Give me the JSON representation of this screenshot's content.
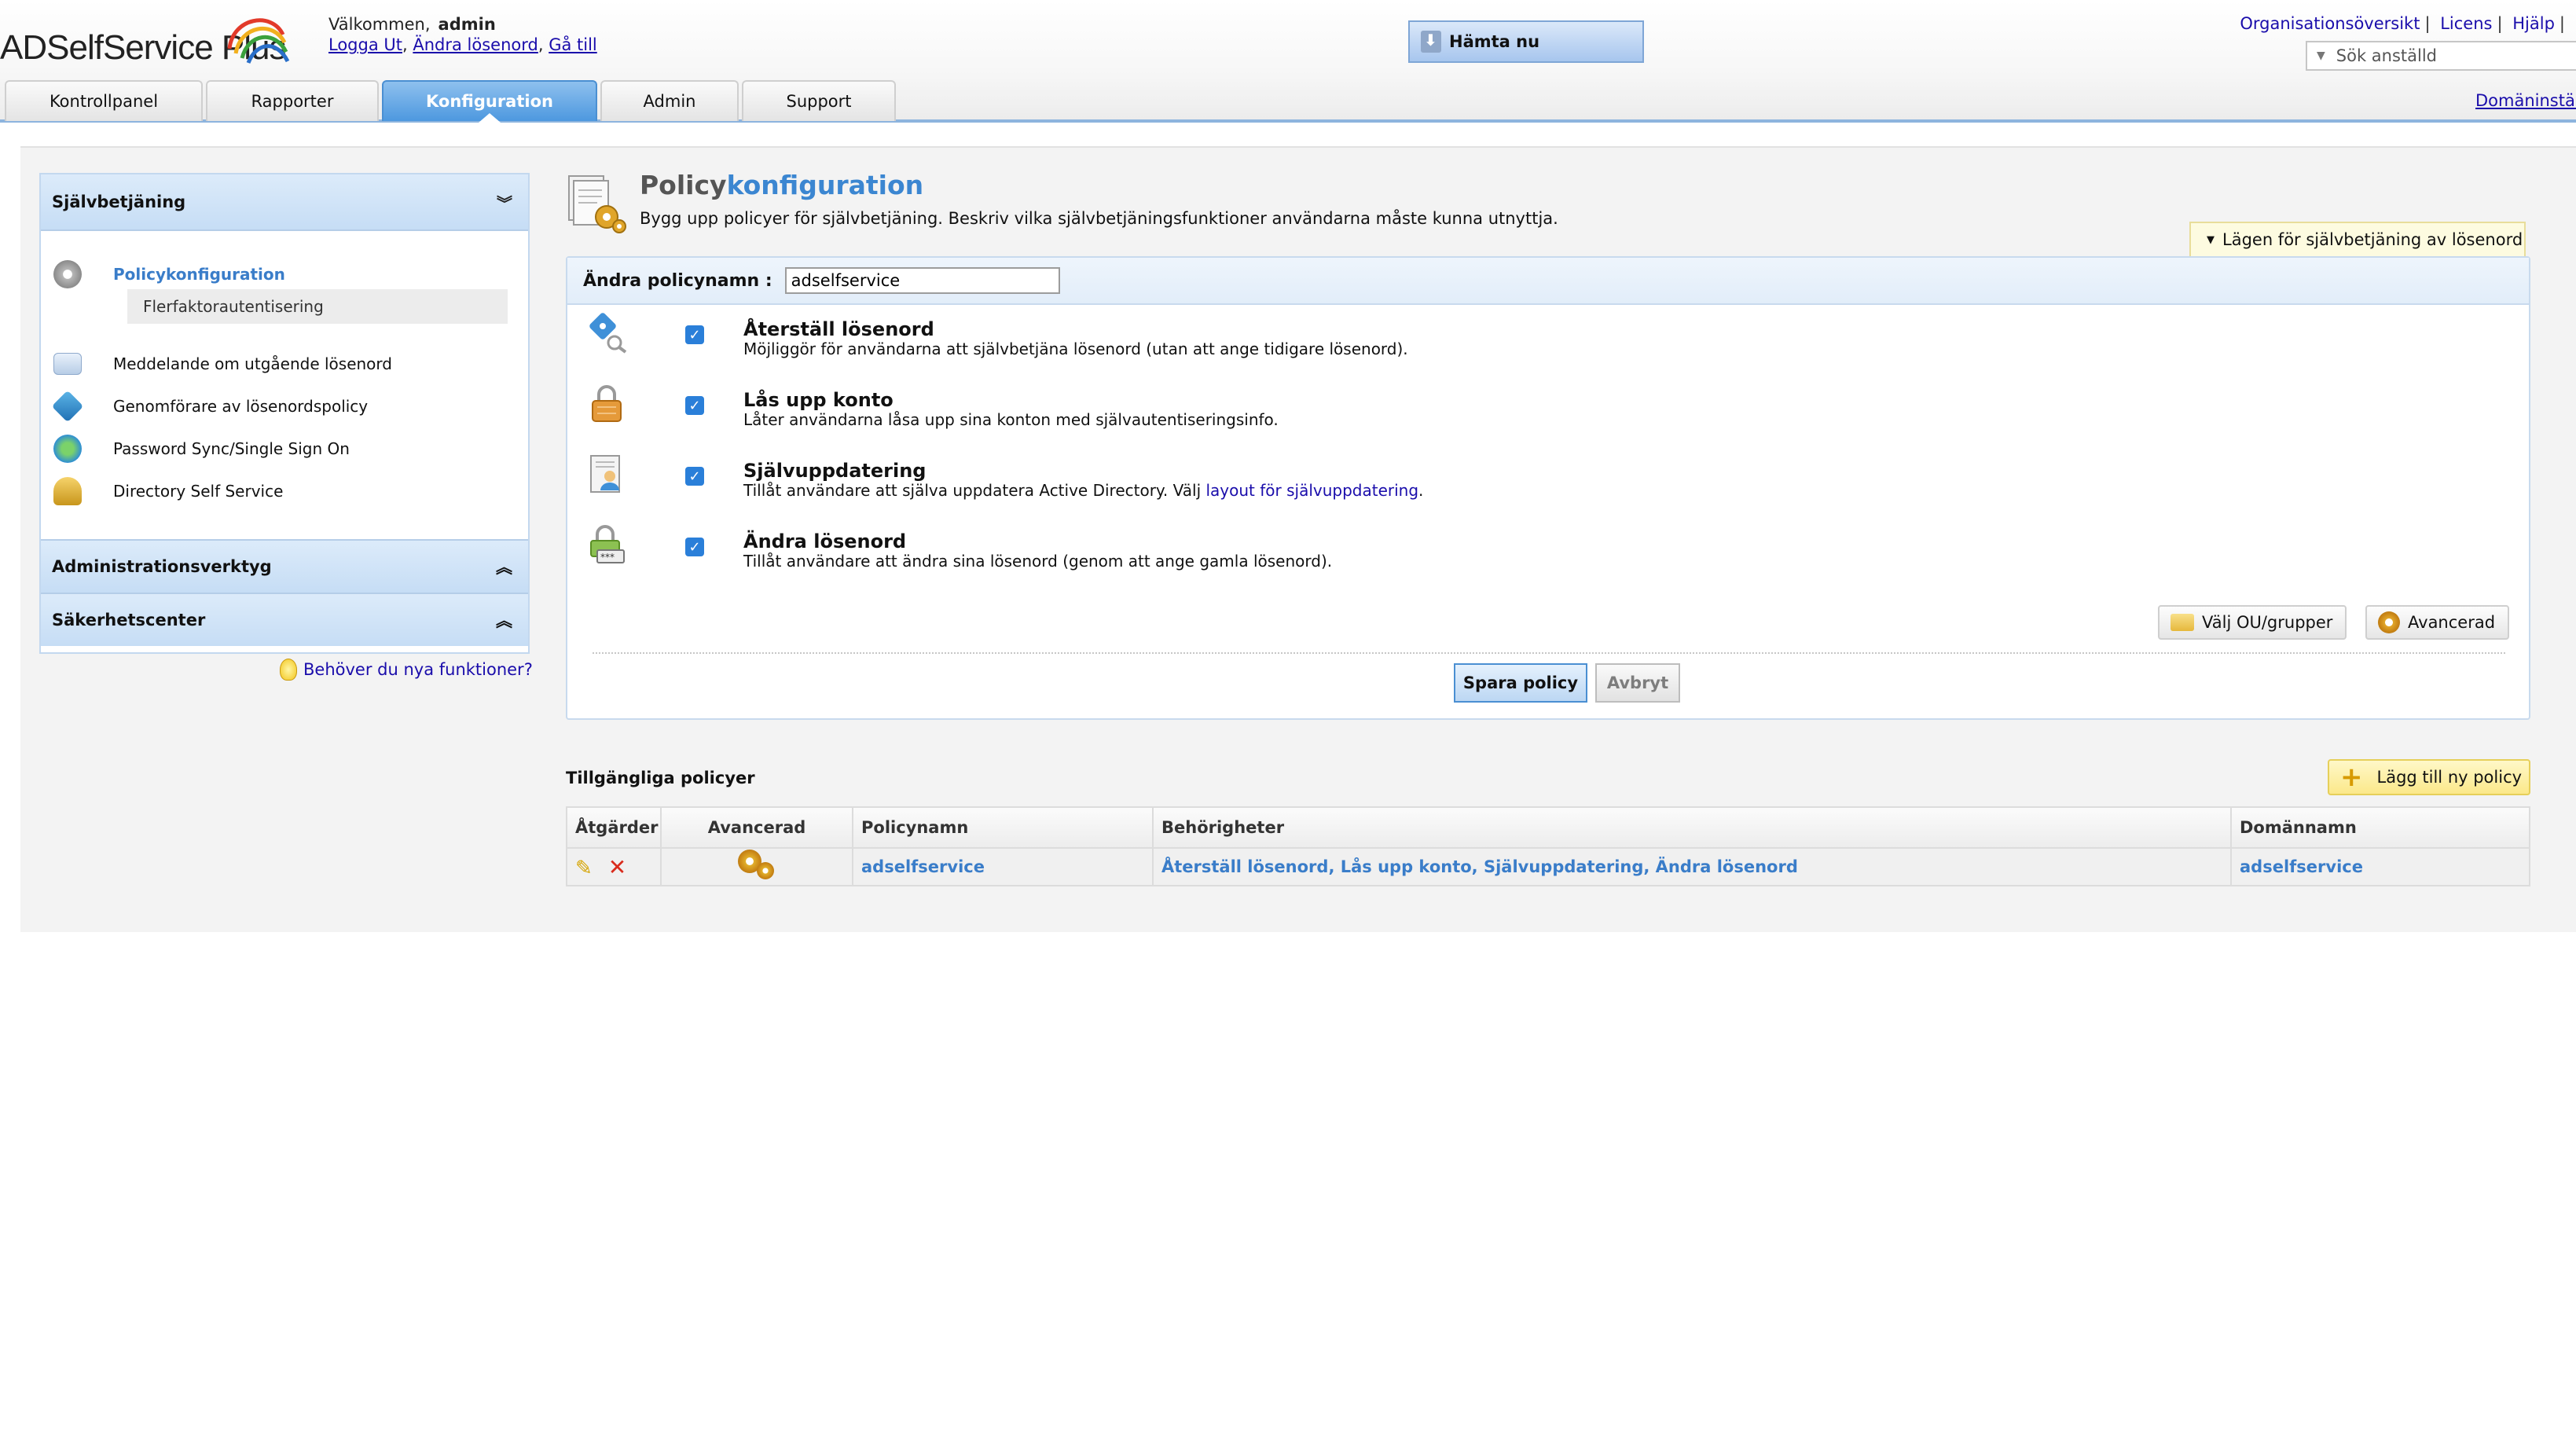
{
  "app": {
    "logo_text": "ADSelfService Plus",
    "welcome": "Välkommen,",
    "user": "admin",
    "logout": "Logga Ut",
    "change_password": "Ändra lösenord",
    "goto": "Gå till",
    "download_button": "Hämta nu",
    "top_links": [
      "Organisationsöversikt",
      "Licens",
      "Hjälp"
    ],
    "search_placeholder": "Sök anställd",
    "domain_settings": "Domäninställ"
  },
  "tabs": [
    {
      "label": "Kontrollpanel",
      "active": false
    },
    {
      "label": "Rapporter",
      "active": false
    },
    {
      "label": "Konfiguration",
      "active": true
    },
    {
      "label": "Admin",
      "active": false
    },
    {
      "label": "Support",
      "active": false
    }
  ],
  "sidebar": {
    "section_title": "Självbetjäning",
    "items": [
      {
        "label": "Policykonfiguration",
        "icon": "gear-icon",
        "active": true
      },
      {
        "label": "Meddelande om utgående lösenord",
        "icon": "envelope-icon"
      },
      {
        "label": "Genomförare av lösenordspolicy",
        "icon": "key-icon"
      },
      {
        "label": "Password Sync/Single Sign On",
        "icon": "sync-icon"
      },
      {
        "label": "Directory Self Service",
        "icon": "user-lock-icon"
      }
    ],
    "sub_item": "Flerfaktorautentisering",
    "collapsed_sections": [
      "Administrationsverktyg",
      "Säkerhetscenter"
    ],
    "new_features_link": "Behöver du nya funktioner?"
  },
  "main": {
    "title_plain": "Policy",
    "title_accent": "konfiguration",
    "description": "Bygg upp policyer för självbetjäning. Beskriv vilka självbetjäningsfunktioner användarna måste kunna utnyttja.",
    "mode_button": "Lägen för självbetjäning av lösenord",
    "policy_name_label": "Ändra policynamn :",
    "policy_name_value": "adselfservice",
    "features": [
      {
        "title": "Återställ lösenord",
        "desc": "Möjliggör för användarna att självbetjäna lösenord (utan att ange tidigare lösenord).",
        "checked": true,
        "icon": "reset-password-icon"
      },
      {
        "title": "Lås upp konto",
        "desc": "Låter användarna låsa upp sina konton med självautentiseringsinfo.",
        "checked": true,
        "icon": "unlock-account-icon"
      },
      {
        "title": "Självuppdatering",
        "desc": "Tillåt användare att själva uppdatera Active Directory. Välj ",
        "link": "layout för självuppdatering",
        "desc_end": ".",
        "checked": true,
        "icon": "self-update-icon"
      },
      {
        "title": "Ändra lösenord",
        "desc": "Tillåt användare att ändra sina lösenord (genom att ange gamla lösenord).",
        "checked": true,
        "icon": "change-password-icon"
      }
    ],
    "select_ou_button": "Välj OU/grupper",
    "advanced_button": "Avancerad",
    "save_button": "Spara policy",
    "cancel_button": "Avbryt"
  },
  "available_policies": {
    "title": "Tillgängliga policyer",
    "add_button": "Lägg till ny policy",
    "columns": [
      "Åtgärder",
      "Avancerad",
      "Policynamn",
      "Behörigheter",
      "Domännamn"
    ],
    "rows": [
      {
        "policy_name": "adselfservice",
        "permissions": "Återställ lösenord, Lås upp konto, Självuppdatering, Ändra lösenord",
        "domain": "adselfservice"
      }
    ]
  },
  "colors": {
    "accent_blue": "#3b86d1",
    "tab_active": "#4d98df",
    "link": "#1a0dab",
    "checkbox": "#2a7fd9"
  }
}
